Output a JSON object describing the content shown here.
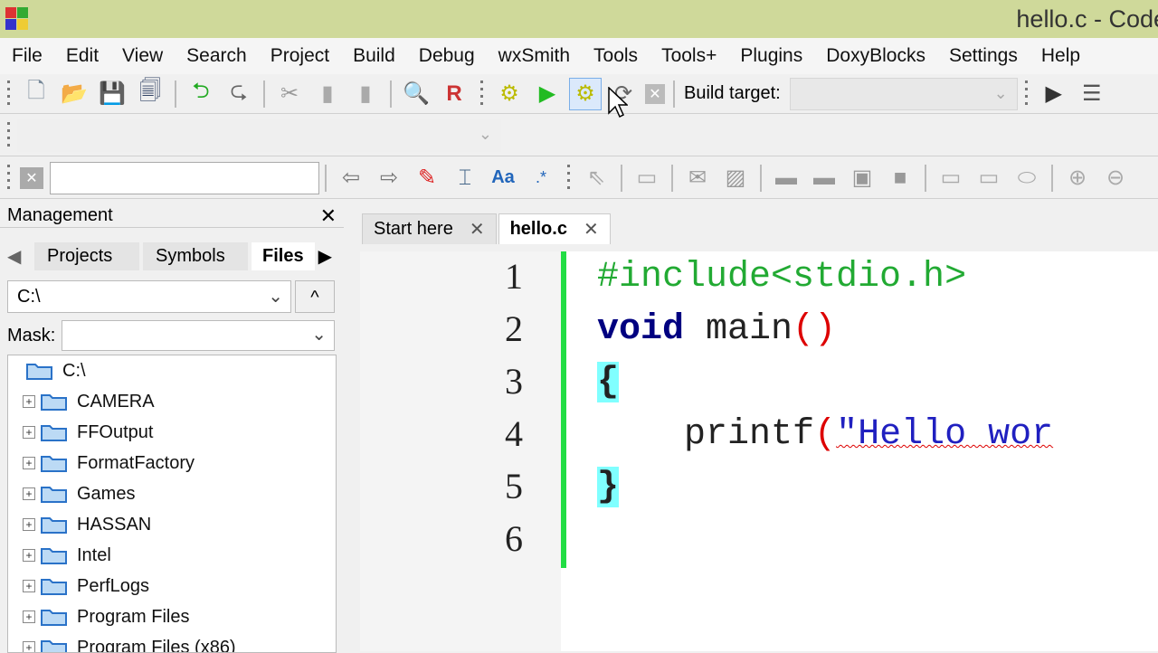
{
  "window": {
    "title": "hello.c - Code"
  },
  "menu": [
    "File",
    "Edit",
    "View",
    "Search",
    "Project",
    "Build",
    "Debug",
    "wxSmith",
    "Tools",
    "Tools+",
    "Plugins",
    "DoxyBlocks",
    "Settings",
    "Help"
  ],
  "toolbar": {
    "build_target_label": "Build target:",
    "build_target_value": ""
  },
  "management": {
    "title": "Management",
    "tabs": [
      "Projects",
      "Symbols",
      "Files"
    ],
    "path": "C:\\",
    "mask_label": "Mask:",
    "mask_value": "",
    "root": "C:\\",
    "folders": [
      "CAMERA",
      "FFOutput",
      "FormatFactory",
      "Games",
      "HASSAN",
      "Intel",
      "PerfLogs",
      "Program Files",
      "Program Files (x86)"
    ]
  },
  "editor": {
    "tabs": [
      {
        "label": "Start here"
      },
      {
        "label": "hello.c"
      }
    ],
    "line_numbers": [
      "1",
      "2",
      "3",
      "4",
      "5",
      "6"
    ],
    "code": {
      "l1": "#include<stdio.h>",
      "l2_kw": "void",
      "l2_rest": " main",
      "l2_paren": "()",
      "l3": "{",
      "l4_fn": "    printf",
      "l4_paren": "(",
      "l4_str": "\"Hello wor",
      "l5": "}"
    }
  },
  "colors": {
    "titlebar": "#cfd99a",
    "preprocessor": "#22aa33",
    "keyword": "#000080",
    "string": "#2020c0",
    "brace_match": "#80ffff",
    "changebar": "#22dd44"
  }
}
